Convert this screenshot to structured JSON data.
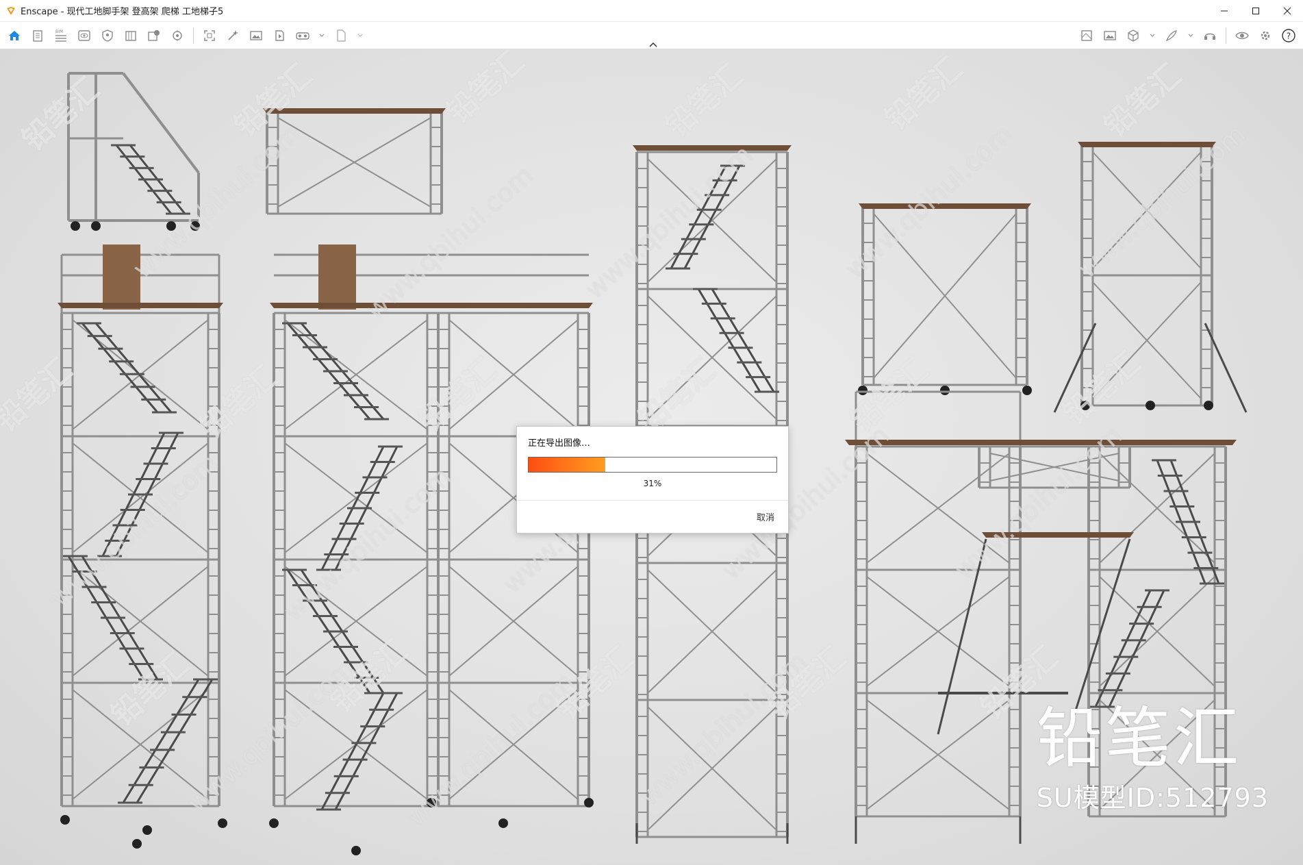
{
  "window": {
    "title": "Enscape - 现代工地脚手架 登高架 爬梯 工地梯子5",
    "accent": "#f39a1e"
  },
  "toolbar": {
    "left_icons": [
      "home-icon",
      "document-icon",
      "bim-icon",
      "eye-view-icon",
      "shield-icon",
      "library-icon",
      "export-icon",
      "settings-wheel-icon",
      "screenshot-icon",
      "magic-wand-icon",
      "image-icon",
      "video-icon",
      "vr-headset-icon",
      "exe-export-icon"
    ],
    "right_icons": [
      "map-icon",
      "image-gallery-icon",
      "cube-icon",
      "feather-icon",
      "headset-icon",
      "eye-icon",
      "gear-icon",
      "help-icon"
    ],
    "home_color": "#1e88e5"
  },
  "dialog": {
    "title": "正在导出图像…",
    "progress_percent": 31,
    "percent_label": "31%",
    "cancel_label": "取消",
    "progress_colors": [
      "#ff4e12",
      "#ff9d20"
    ]
  },
  "watermark": {
    "text": "铅笔汇",
    "url": "www.qbihui.com",
    "logo": "铅笔汇",
    "model_id": "SU模型ID:512793"
  }
}
